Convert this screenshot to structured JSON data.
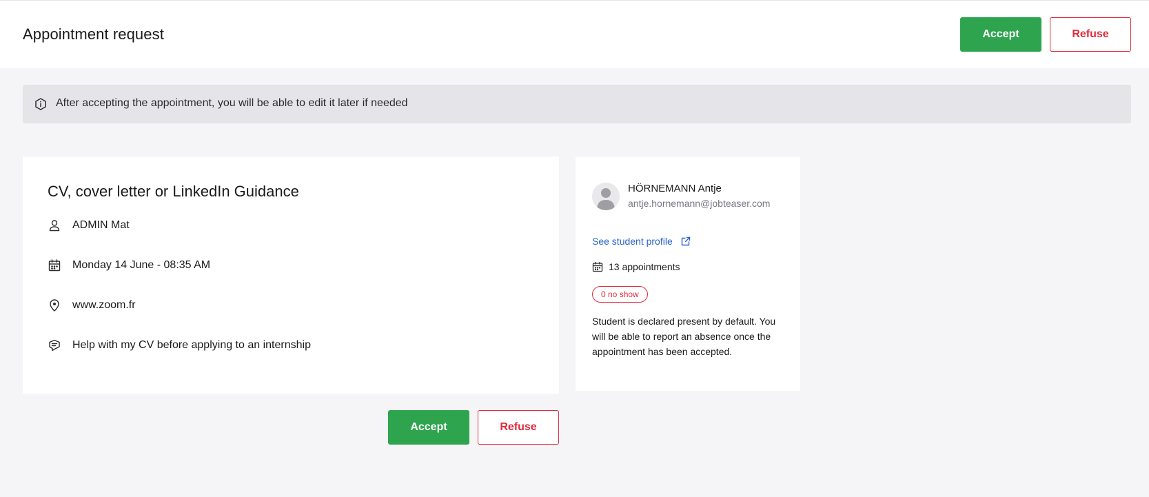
{
  "header": {
    "title": "Appointment request",
    "accept_label": "Accept",
    "refuse_label": "Refuse"
  },
  "banner": {
    "icon": "info-icon",
    "text": "After accepting the appointment, you will be able to edit it later if needed"
  },
  "appointment": {
    "title": "CV, cover letter or LinkedIn Guidance",
    "details": [
      {
        "icon": "person-icon",
        "text": "ADMIN Mat"
      },
      {
        "icon": "calendar-icon",
        "text": "Monday 14 June - 08:35 AM"
      },
      {
        "icon": "location-pin-icon",
        "text": "www.zoom.fr"
      },
      {
        "icon": "message-icon",
        "text": "Help with my CV before applying to an internship"
      }
    ]
  },
  "actions": {
    "accept_label": "Accept",
    "refuse_label": "Refuse"
  },
  "student": {
    "name": "HÖRNEMANN Antje",
    "email": "antje.hornemann@jobteaser.com",
    "profile_link_label": "See student profile",
    "appointments_count_label": "13 appointments",
    "no_show_label": "0 no show",
    "note": "Student is declared present by default. You will be able to report an absence once the appointment has been accepted."
  },
  "colors": {
    "accept": "#2ea44f",
    "refuse": "#e02a3b",
    "link": "#2a62c9",
    "page_bg": "#f5f5f7",
    "banner_bg": "#e5e5e9"
  }
}
